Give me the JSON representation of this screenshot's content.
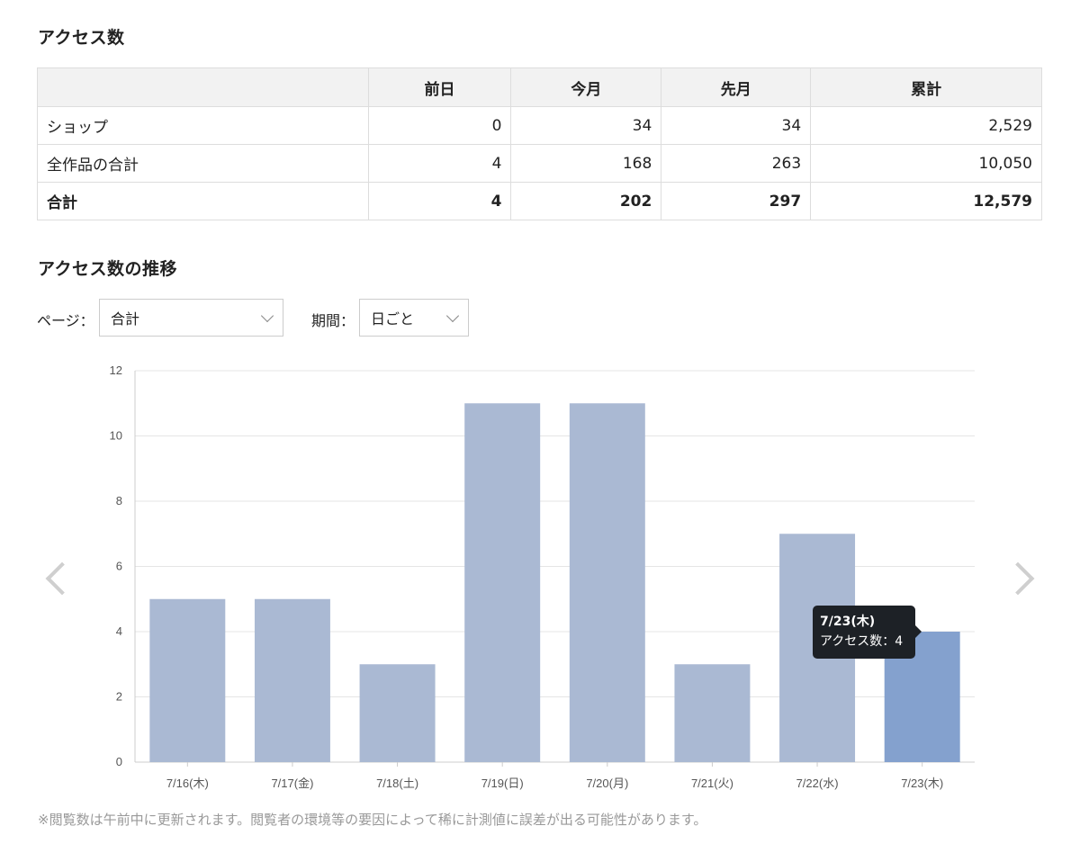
{
  "access_section": {
    "title": "アクセス数",
    "table": {
      "headers": [
        "",
        "前日",
        "今月",
        "先月",
        "累計"
      ],
      "rows": [
        {
          "label": "ショップ",
          "values": [
            "0",
            "34",
            "34",
            "2,529"
          ]
        },
        {
          "label": "全作品の合計",
          "values": [
            "4",
            "168",
            "263",
            "10,050"
          ]
        },
        {
          "label": "合計",
          "values": [
            "4",
            "202",
            "297",
            "12,579"
          ]
        }
      ]
    }
  },
  "trend_section": {
    "title": "アクセス数の推移",
    "filters": {
      "page_label": "ページ：",
      "page_value": "合計",
      "period_label": "期間：",
      "period_value": "日ごと"
    }
  },
  "chart_data": {
    "type": "bar",
    "categories": [
      "7/16(木)",
      "7/17(金)",
      "7/18(土)",
      "7/19(日)",
      "7/20(月)",
      "7/21(火)",
      "7/22(水)",
      "7/23(木)"
    ],
    "values": [
      5,
      5,
      3,
      11,
      11,
      3,
      7,
      4
    ],
    "ylim": [
      0,
      12
    ],
    "yticks": [
      0,
      2,
      4,
      6,
      8,
      10,
      12
    ],
    "grid": true,
    "highlighted_index": 7,
    "colors": {
      "bar": "#aab9d3",
      "bar_highlight": "#84a1ce",
      "grid": "#e5e5e5",
      "axis": "#cccccc"
    }
  },
  "tooltip": {
    "title": "7/23(木)",
    "line": "アクセス数：4"
  },
  "icons": {
    "prev": "chevron-left-icon",
    "next": "chevron-right-icon",
    "dropdown": "chevron-down-icon"
  },
  "footnote": "※閲覧数は午前中に更新されます。閲覧者の環境等の要因によって稀に計測値に誤差が出る可能性があります。"
}
